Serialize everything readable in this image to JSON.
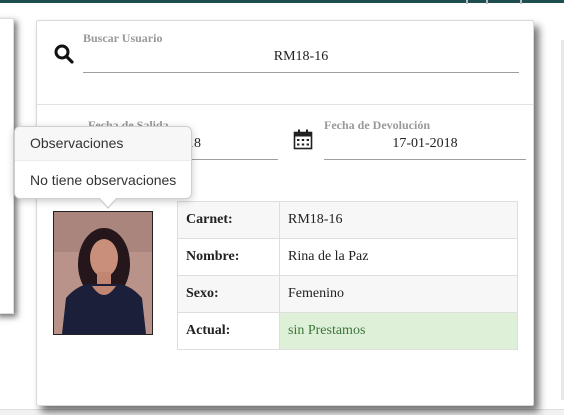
{
  "search": {
    "label": "Buscar Usuario",
    "value": "RM18-16",
    "icon": "search-icon"
  },
  "dates": {
    "salida_label": "Fecha de Salida",
    "salida_value": "18",
    "devolucion_label": "Fecha de Devolución",
    "devolucion_value": "17-01-2018",
    "icon": "calendar-icon"
  },
  "popover": {
    "title": "Observaciones",
    "body": "No tiene observaciones"
  },
  "user": {
    "photo_icon": "user-photo",
    "rows": [
      {
        "label": "Carnet:",
        "value": "RM18-16"
      },
      {
        "label": "Nombre:",
        "value": "Rina de la Paz"
      },
      {
        "label": "Sexo:",
        "value": "Femenino"
      },
      {
        "label": "Actual:",
        "value": "sin Prestamos"
      }
    ]
  },
  "colors": {
    "status_bg": "#dff0d8",
    "status_text": "#3c763d",
    "top_bar": "#1d4f4f"
  }
}
